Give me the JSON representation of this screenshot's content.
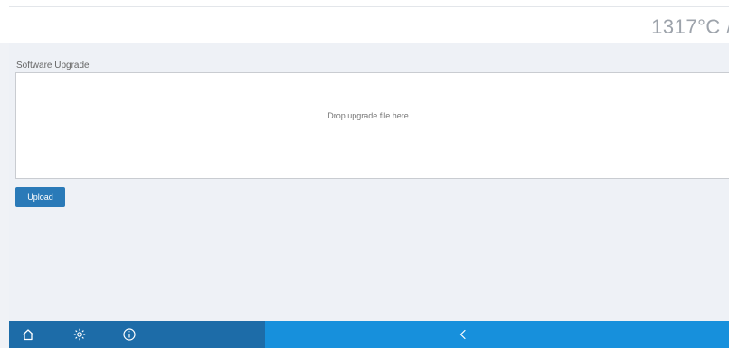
{
  "header": {
    "temperature": "1317°C /"
  },
  "software_upgrade": {
    "title": "Software Upgrade",
    "dropzone_text": "Drop upgrade file here",
    "upload_label": "Upload"
  },
  "footer": {
    "icons": [
      "home-icon",
      "settings-icon",
      "info-icon",
      "back-chevron-icon"
    ]
  },
  "colors": {
    "accent": "#2a7ab8",
    "footer_dark": "#1d6ca8",
    "footer_light": "#1790dc"
  }
}
